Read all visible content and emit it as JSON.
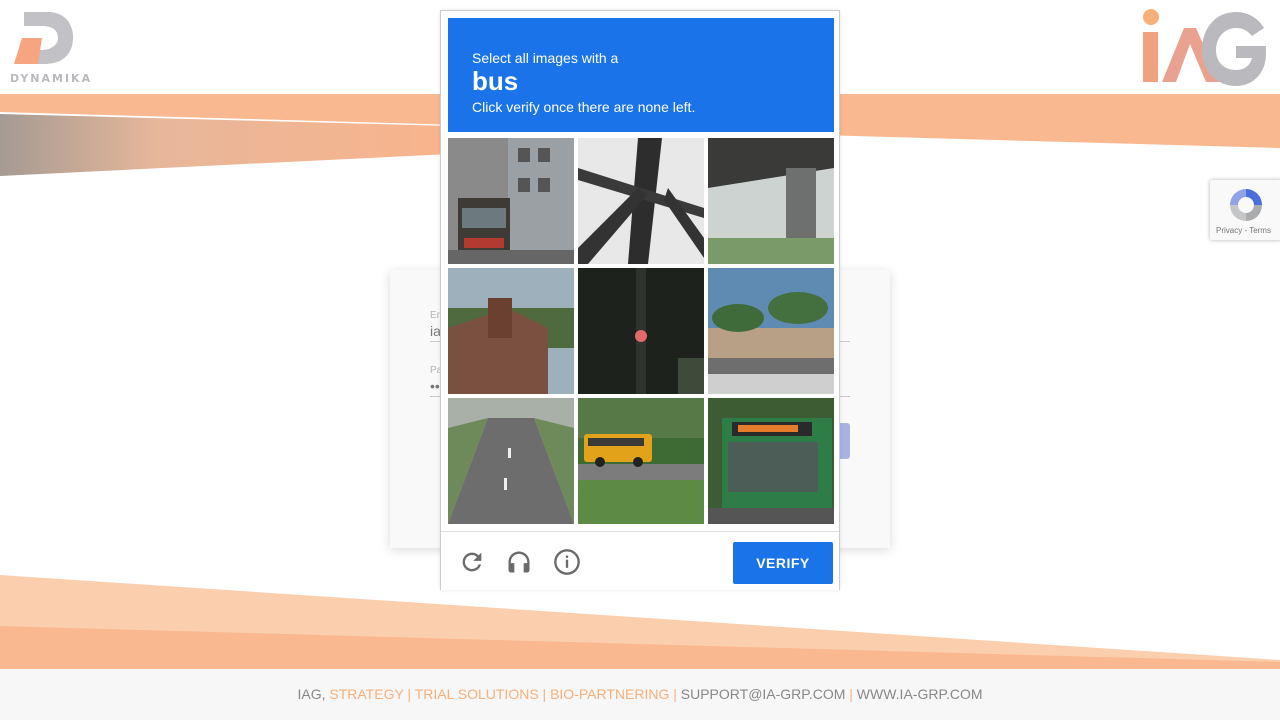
{
  "brand": {
    "left_logo_text": "DYNAMIKA",
    "right_logo_text": "iAG",
    "colors": {
      "orange": "#f7b07a",
      "grey": "#b9b9be",
      "blue": "#1a73e8"
    }
  },
  "login": {
    "email_label": "Em",
    "email_value": "ia",
    "password_label": "Pa",
    "password_value": "••"
  },
  "captcha": {
    "instruction_line1": "Select all images with a",
    "target_word": "bus",
    "instruction_line3": "Click verify once there are none left.",
    "tiles": [
      {
        "label": "bus front beside building"
      },
      {
        "label": "bridge truss"
      },
      {
        "label": "overpass pillar"
      },
      {
        "label": "brick chimney"
      },
      {
        "label": "traffic light at night"
      },
      {
        "label": "palm trees and fence"
      },
      {
        "label": "road"
      },
      {
        "label": "school bus"
      },
      {
        "label": "green bus"
      }
    ],
    "reload_icon": "reload-icon",
    "audio_icon": "headphones-icon",
    "info_icon": "info-icon",
    "verify_label": "VERIFY"
  },
  "recaptcha_badge": {
    "links_text": "Privacy - Terms"
  },
  "footer": {
    "part1": "IAG, ",
    "part2": "STRATEGY | TRIAL SOLUTIONS | BIO-PARTNERING | ",
    "email": "SUPPORT@IA-GRP.COM",
    "separator": " | ",
    "website": "WWW.IA-GRP.COM"
  }
}
